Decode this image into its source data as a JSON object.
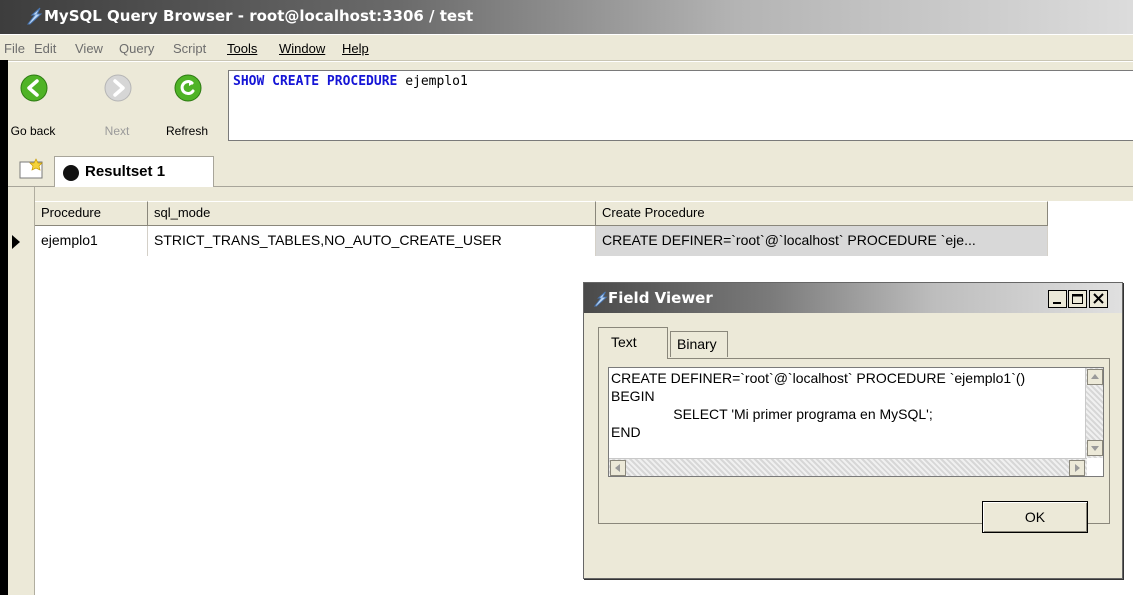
{
  "window": {
    "title": "MySQL Query Browser - root@localhost:3306 / test"
  },
  "menu": [
    {
      "label": "File",
      "active": false
    },
    {
      "label": "Edit",
      "active": false
    },
    {
      "label": "View",
      "active": false
    },
    {
      "label": "Query",
      "active": false
    },
    {
      "label": "Script",
      "active": false
    },
    {
      "label": "Tools",
      "active": true
    },
    {
      "label": "Window",
      "active": true
    },
    {
      "label": "Help",
      "active": true
    }
  ],
  "toolbar": {
    "back_label": "Go back",
    "next_label": "Next",
    "refresh_label": "Refresh",
    "icons": {
      "back": "arrow-left-icon",
      "next": "arrow-right-icon",
      "refresh": "refresh-icon"
    },
    "accent": "#3aa21e"
  },
  "query": {
    "keywords": "SHOW CREATE PROCEDURE",
    "rest": " ejemplo1",
    "keyword_color": "#1515d6"
  },
  "tabs": {
    "resultset_label": "Resultset 1",
    "new_tab_icon": "new-tab-icon"
  },
  "grid": {
    "columns": [
      "Procedure",
      "sql_mode",
      "Create Procedure"
    ],
    "rows": [
      [
        "ejemplo1",
        "STRICT_TRANS_TABLES,NO_AUTO_CREATE_USER",
        "CREATE DEFINER=`root`@`localhost` PROCEDURE `eje..."
      ]
    ]
  },
  "dialog": {
    "title": "Field Viewer",
    "tab_text": "Text",
    "tab_binary": "Binary",
    "content": "CREATE DEFINER=`root`@`localhost` PROCEDURE `ejemplo1`()\nBEGIN\n                SELECT 'Mi primer programa en MySQL';\nEND",
    "ok_label": "OK"
  }
}
